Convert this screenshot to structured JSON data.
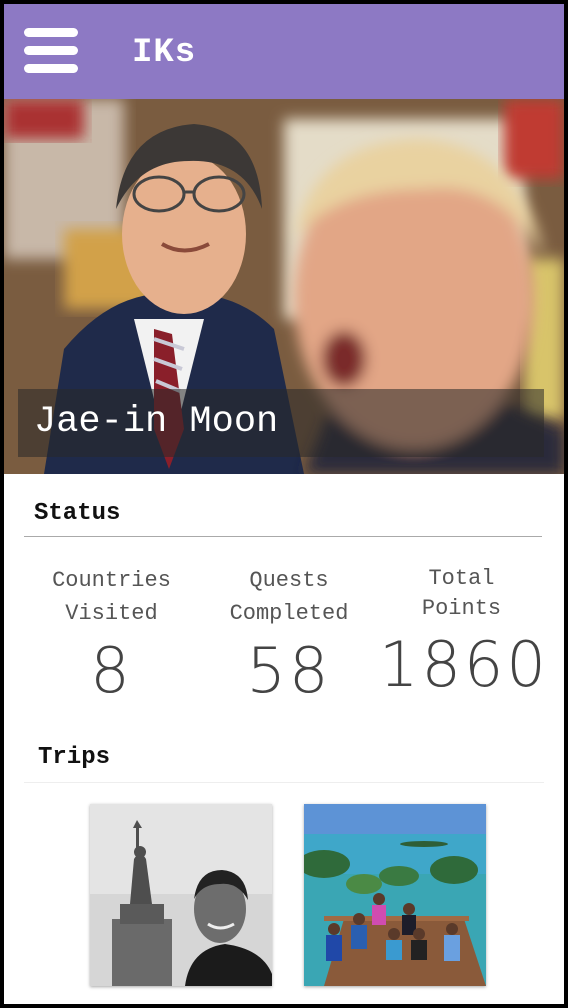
{
  "header": {
    "title": "IKs",
    "menu_icon": "hamburger-menu-icon"
  },
  "profile": {
    "name": "Jae-in Moon"
  },
  "status": {
    "title": "Status",
    "stats": [
      {
        "label_line1": "Countries",
        "label_line2": "Visited",
        "value": "8"
      },
      {
        "label_line1": "Quests",
        "label_line2": "Completed",
        "value": "58"
      },
      {
        "label_line1": "Total",
        "label_line2": "Points",
        "value": "1860"
      }
    ]
  },
  "trips": {
    "title": "Trips"
  },
  "colors": {
    "header_bg": "#8d79c4",
    "header_text": "#ffffff"
  }
}
